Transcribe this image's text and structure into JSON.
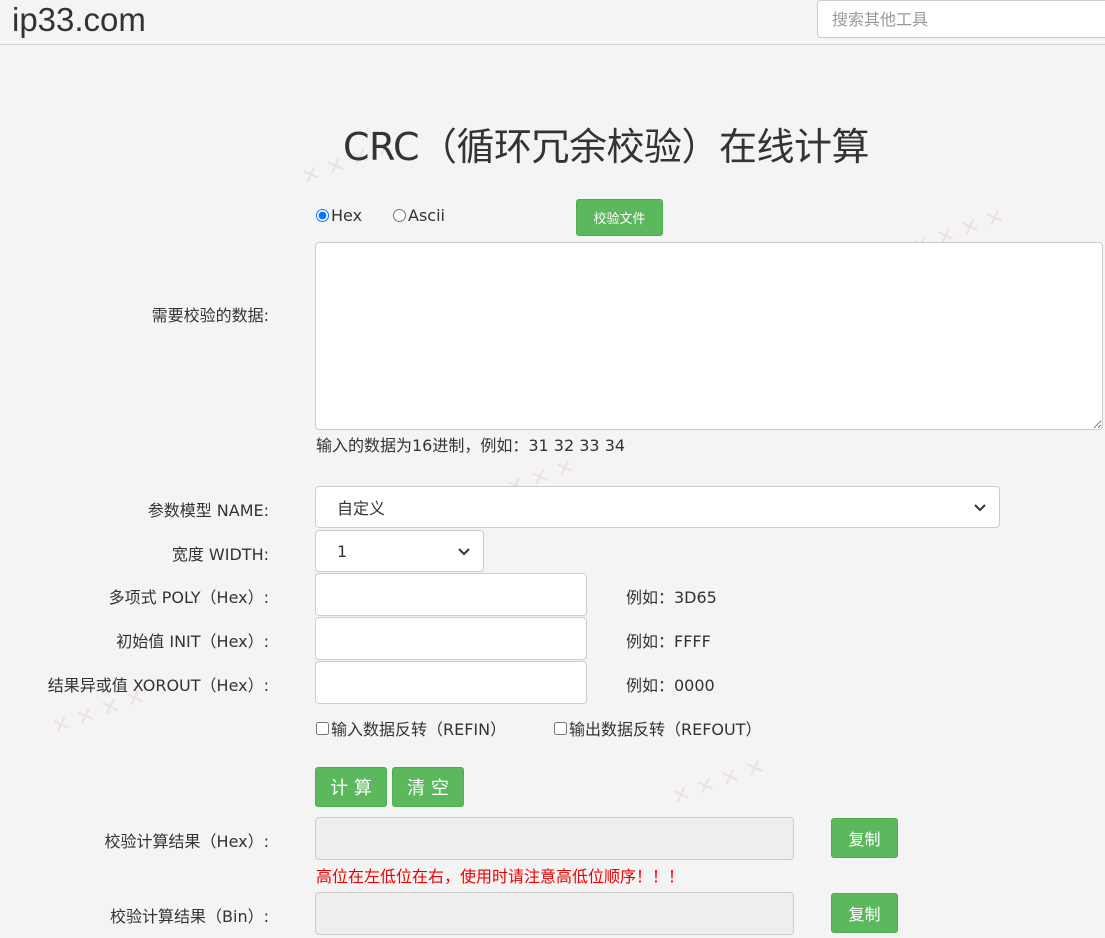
{
  "header": {
    "logo": "ip33.com",
    "search_placeholder": "搜索其他工具"
  },
  "title": "CRC（循环冗余校验）在线计算",
  "mode": {
    "hex_label": "Hex",
    "ascii_label": "Ascii",
    "selected": "Hex",
    "file_button": "校验文件"
  },
  "data": {
    "label": "需要校验的数据:",
    "value": "",
    "hint": "输入的数据为16进制，例如：31 32 33 34"
  },
  "params": {
    "name_label": "参数模型 NAME:",
    "name_value": "自定义",
    "width_label": "宽度 WIDTH:",
    "width_value": "1",
    "poly_label": "多项式 POLY（Hex）:",
    "poly_example": "例如：3D65",
    "init_label": "初始值 INIT（Hex）:",
    "init_example": "例如：FFFF",
    "xorout_label": "结果异或值 XOROUT（Hex）:",
    "xorout_example": "例如：0000",
    "refin_label": "输入数据反转（REFIN）",
    "refout_label": "输出数据反转（REFOUT）"
  },
  "actions": {
    "calc": "计 算",
    "clear": "清 空"
  },
  "results": {
    "hex_label": "校验计算结果（Hex）:",
    "bin_label": "校验计算结果（Bin）:",
    "copy": "复制",
    "warning": "高位在左低位在右，使用时请注意高低位顺序！！！"
  },
  "colors": {
    "green": "#5cb85c",
    "warning": "#e00000"
  }
}
